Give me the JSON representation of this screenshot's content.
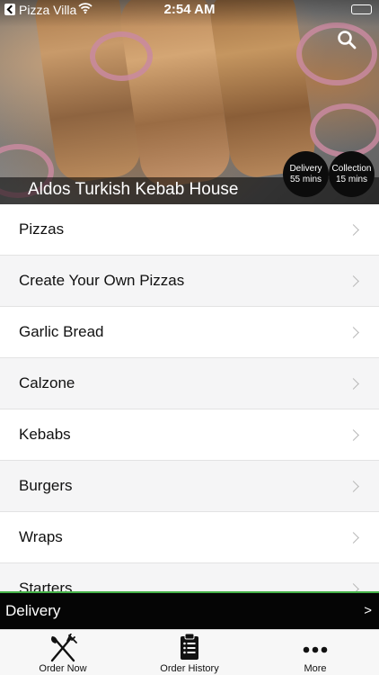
{
  "status_bar": {
    "app_name": "Pizza Villa",
    "time": "2:54 AM"
  },
  "header": {
    "restaurant_name": "Aldos Turkish Kebab House",
    "delivery_label": "Delivery",
    "delivery_time": "55 mins",
    "collection_label": "Collection",
    "collection_time": "15 mins"
  },
  "menu": {
    "categories": [
      {
        "label": "Pizzas"
      },
      {
        "label": "Create Your Own Pizzas"
      },
      {
        "label": "Garlic Bread"
      },
      {
        "label": "Calzone"
      },
      {
        "label": "Kebabs"
      },
      {
        "label": "Burgers"
      },
      {
        "label": "Wraps"
      },
      {
        "label": "Starters"
      }
    ]
  },
  "delivery_bar": {
    "label": "Delivery",
    "arrow": ">"
  },
  "tab_bar": {
    "order_now": "Order Now",
    "order_history": "Order History",
    "more": "More"
  },
  "colors": {
    "accent_green": "#47b34a",
    "bar_black": "#050505"
  }
}
